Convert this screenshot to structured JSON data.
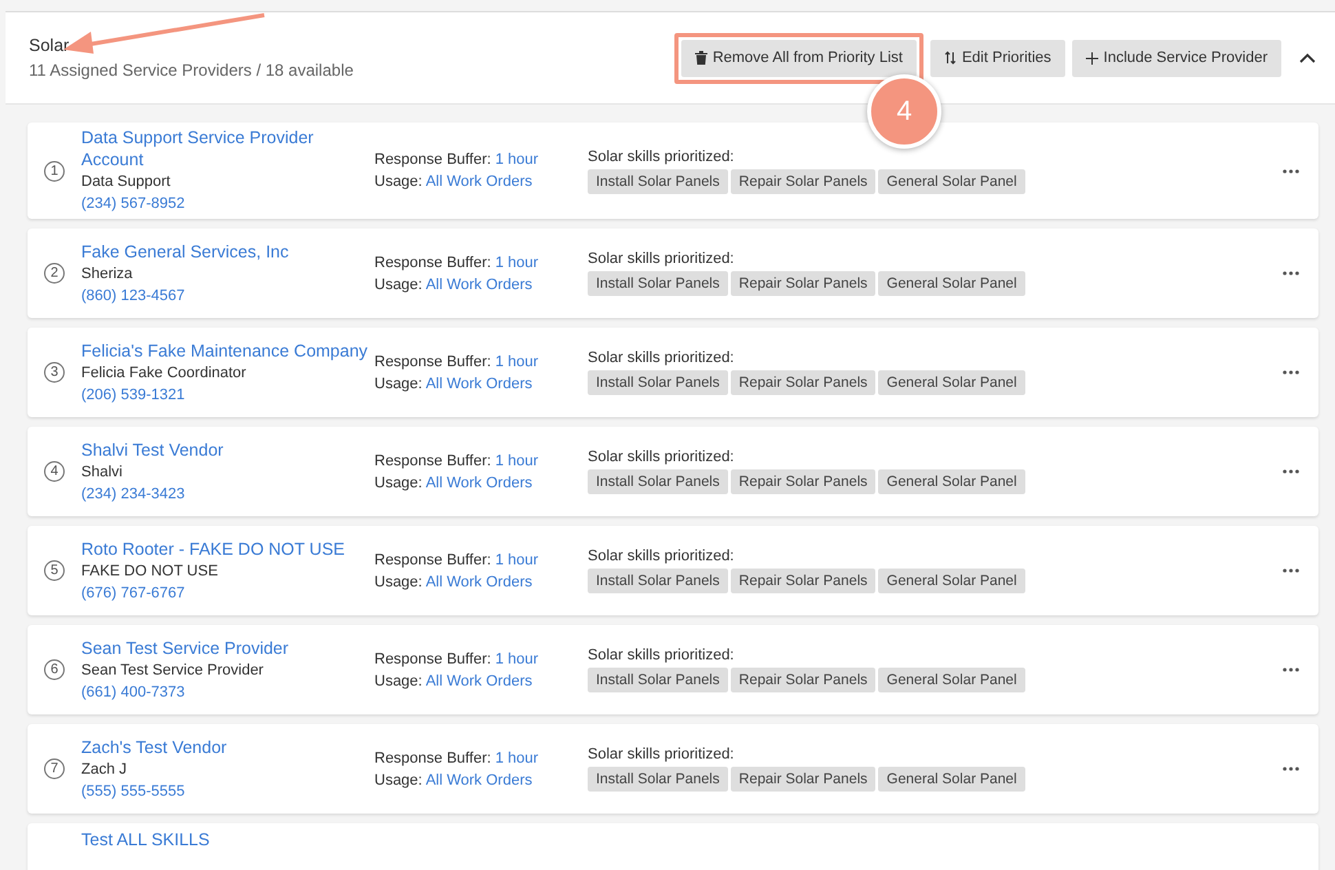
{
  "section": {
    "title": "Solar",
    "subtitle": "11 Assigned Service Providers / 18 available",
    "buttons": [
      {
        "kind": "trash",
        "label": "Remove All from Priority List",
        "highlighted": true
      },
      {
        "kind": "sort",
        "label": "Edit Priorities",
        "highlighted": false
      },
      {
        "kind": "plus",
        "label": "Include Service Provider",
        "highlighted": false
      }
    ],
    "expanded": true
  },
  "annotation": {
    "badge": "4"
  },
  "providers": [
    {
      "rank": "1",
      "name": "Data Support Service Provider Account",
      "contact": "Data Support",
      "phone": "(234) 567-8952",
      "buffer_label": "Response Buffer:",
      "buffer": "1 hour",
      "usage_label": "Usage:",
      "usage": "All Work Orders",
      "skills_label": "Solar skills prioritized:",
      "skills": [
        "Install Solar Panels",
        "Repair Solar Panels",
        "General Solar Panel"
      ]
    },
    {
      "rank": "2",
      "name": "Fake General Services, Inc",
      "contact": "Sheriza",
      "phone": "(860) 123-4567",
      "buffer_label": "Response Buffer:",
      "buffer": "1 hour",
      "usage_label": "Usage:",
      "usage": "All Work Orders",
      "skills_label": "Solar skills prioritized:",
      "skills": [
        "Install Solar Panels",
        "Repair Solar Panels",
        "General Solar Panel"
      ]
    },
    {
      "rank": "3",
      "name": "Felicia's Fake Maintenance Company",
      "contact": "Felicia Fake Coordinator",
      "phone": "(206) 539-1321",
      "buffer_label": "Response Buffer:",
      "buffer": "1 hour",
      "usage_label": "Usage:",
      "usage": "All Work Orders",
      "skills_label": "Solar skills prioritized:",
      "skills": [
        "Install Solar Panels",
        "Repair Solar Panels",
        "General Solar Panel"
      ]
    },
    {
      "rank": "4",
      "name": "Shalvi Test Vendor",
      "contact": "Shalvi",
      "phone": "(234) 234-3423",
      "buffer_label": "Response Buffer:",
      "buffer": "1 hour",
      "usage_label": "Usage:",
      "usage": "All Work Orders",
      "skills_label": "Solar skills prioritized:",
      "skills": [
        "Install Solar Panels",
        "Repair Solar Panels",
        "General Solar Panel"
      ]
    },
    {
      "rank": "5",
      "name": "Roto Rooter - FAKE DO NOT USE",
      "contact": "FAKE DO NOT USE",
      "phone": "(676) 767-6767",
      "buffer_label": "Response Buffer:",
      "buffer": "1 hour",
      "usage_label": "Usage:",
      "usage": "All Work Orders",
      "skills_label": "Solar skills prioritized:",
      "skills": [
        "Install Solar Panels",
        "Repair Solar Panels",
        "General Solar Panel"
      ]
    },
    {
      "rank": "6",
      "name": "Sean Test Service Provider",
      "contact": "Sean Test Service Provider",
      "phone": "(661) 400-7373",
      "buffer_label": "Response Buffer:",
      "buffer": "1 hour",
      "usage_label": "Usage:",
      "usage": "All Work Orders",
      "skills_label": "Solar skills prioritized:",
      "skills": [
        "Install Solar Panels",
        "Repair Solar Panels",
        "General Solar Panel"
      ]
    },
    {
      "rank": "7",
      "name": "Zach's Test Vendor",
      "contact": "Zach J",
      "phone": "(555) 555-5555",
      "buffer_label": "Response Buffer:",
      "buffer": "1 hour",
      "usage_label": "Usage:",
      "usage": "All Work Orders",
      "skills_label": "Solar skills prioritized:",
      "skills": [
        "Install Solar Panels",
        "Repair Solar Panels",
        "General Solar Panel"
      ]
    },
    {
      "name": "Test ALL SKILLS"
    }
  ]
}
